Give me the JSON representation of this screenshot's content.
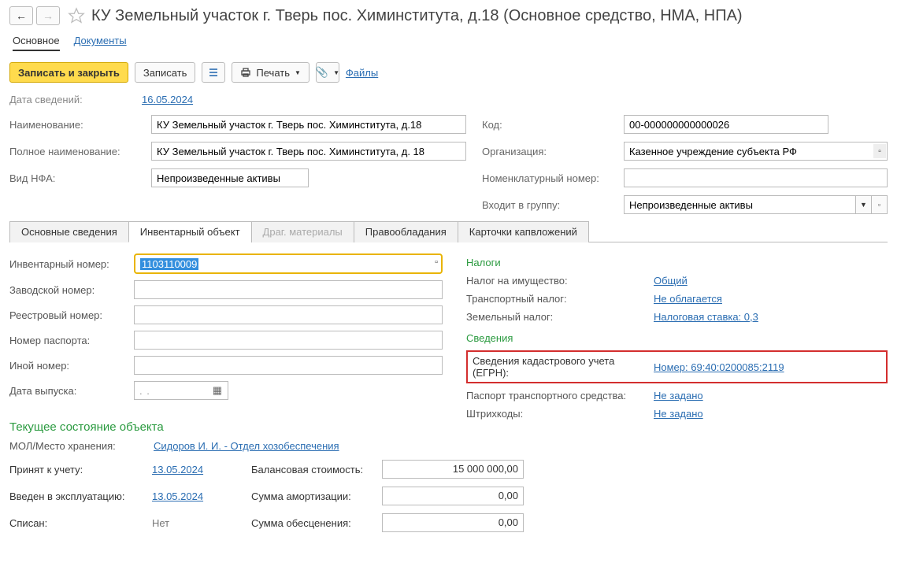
{
  "header": {
    "title": "КУ Земельный участок г. Тверь пос. Химинститута, д.18 (Основное средство, НМА, НПА)"
  },
  "section_tabs": {
    "main": "Основное",
    "docs": "Документы"
  },
  "toolbar": {
    "save_close": "Записать и закрыть",
    "save": "Записать",
    "print": "Печать",
    "files": "Файлы"
  },
  "info": {
    "date_label": "Дата сведений:",
    "date_value": "16.05.2024",
    "name_label": "Наименование:",
    "name_value": "КУ Земельный участок г. Тверь пос. Химинститута, д.18",
    "fullname_label": "Полное наименование:",
    "fullname_value": "КУ Земельный участок г. Тверь пос. Химинститута, д. 18",
    "nfa_label": "Вид НФА:",
    "nfa_value": "Непроизведенные активы",
    "code_label": "Код:",
    "code_value": "00-000000000000026",
    "org_label": "Организация:",
    "org_value": "Казенное учреждение субъекта РФ",
    "nomen_label": "Номенклатурный номер:",
    "nomen_value": "",
    "group_label": "Входит в группу:",
    "group_value": "Непроизведенные активы"
  },
  "tabs": {
    "t1": "Основные сведения",
    "t2": "Инвентарный объект",
    "t3": "Драг. материалы",
    "t4": "Правообладания",
    "t5": "Карточки капвложений"
  },
  "inv": {
    "inv_num_label": "Инвентарный номер:",
    "inv_num_value": "1103110009",
    "factory_label": "Заводской номер:",
    "factory_value": "",
    "registry_label": "Реестровый номер:",
    "registry_value": "",
    "passport_label": "Номер паспорта:",
    "passport_value": "",
    "other_label": "Иной номер:",
    "other_value": "",
    "release_label": "Дата выпуска:",
    "release_value": ".   .    "
  },
  "tax": {
    "header": "Налоги",
    "property_label": "Налог на имущество:",
    "property_value": "Общий",
    "transport_label": "Транспортный налог:",
    "transport_value": "Не облагается",
    "land_label": "Земельный налог:",
    "land_value": "Налоговая ставка: 0,3"
  },
  "details": {
    "header": "Сведения",
    "egrn_label": "Сведения кадастрового учета (ЕГРН):",
    "egrn_value": "Номер: 69:40:0200085:2119",
    "pts_label": "Паспорт транспортного средства:",
    "pts_value": "Не задано",
    "barcode_label": "Штрихкоды:",
    "barcode_value": "Не задано"
  },
  "state": {
    "header": "Текущее состояние объекта",
    "mol_label": "МОЛ/Место хранения:",
    "mol_value": "Сидоров И. И. - Отдел хозобеспечения",
    "accepted_label": "Принят к учету:",
    "accepted_value": "13.05.2024",
    "inuse_label": "Введен в эксплуатацию:",
    "inuse_value": "13.05.2024",
    "writeoff_label": "Списан:",
    "writeoff_value": "Нет",
    "balance_label": "Балансовая стоимость:",
    "balance_value": "15 000 000,00",
    "amort_label": "Сумма амортизации:",
    "amort_value": "0,00",
    "impair_label": "Сумма обесценения:",
    "impair_value": "0,00"
  }
}
